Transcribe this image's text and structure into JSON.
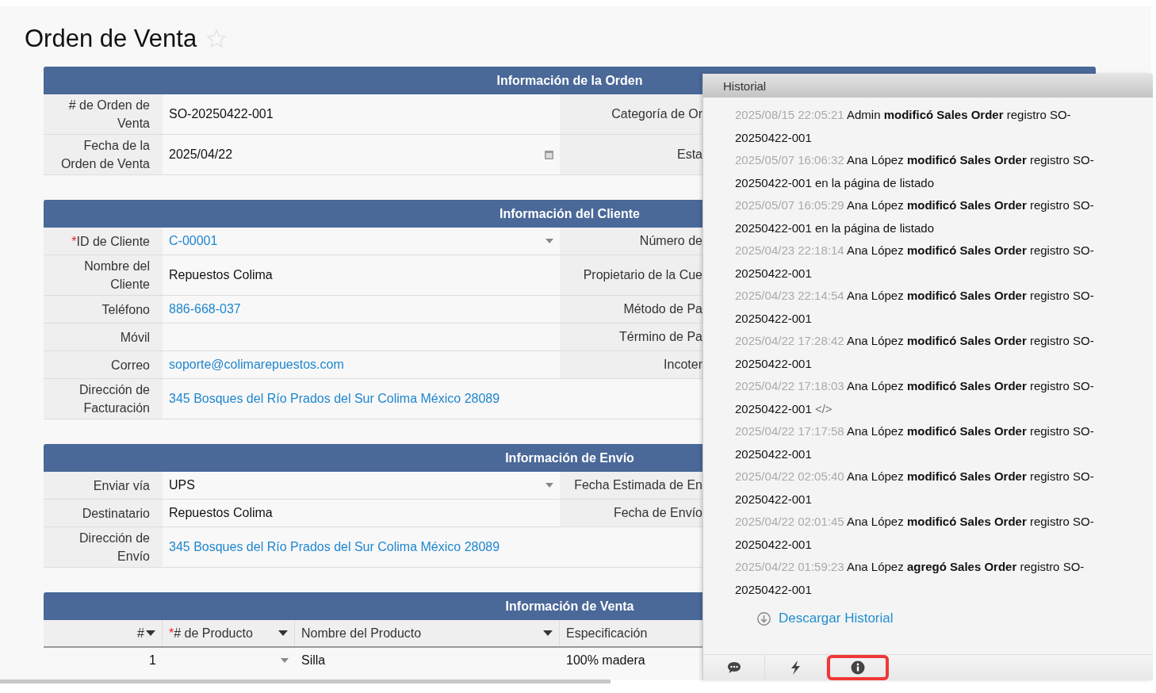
{
  "title": "Orden de Venta",
  "favorite": false,
  "sections": [
    {
      "title": "Información de la Orden",
      "rows": [
        {
          "label": "# de Orden de Venta",
          "kind": "text",
          "value": "SO-20250422-001",
          "right_label": "Categoría de Or"
        },
        {
          "label": "Fecha de la Orden de Venta",
          "kind": "date",
          "value": "2025/04/22",
          "right_label": "Esta"
        }
      ]
    },
    {
      "title": "Información del Cliente",
      "rows": [
        {
          "label": "ID de Cliente",
          "marker": "*",
          "kind": "select_link",
          "value": "C-00001",
          "right_label": "Número de"
        },
        {
          "label": "Nombre del Cliente",
          "kind": "text",
          "value": "Repuestos Colima",
          "right_label": "Propietario de la Cue"
        },
        {
          "label": "Teléfono",
          "kind": "link",
          "value": "886-668-037",
          "right_label": "Método de Pa"
        },
        {
          "label": "Móvil",
          "kind": "text",
          "right_label": "Término de Pa"
        },
        {
          "label": "Correo",
          "kind": "link",
          "value": "soporte@colimarepuestos.com",
          "right_label": "Incoter"
        },
        {
          "label": "Dirección de Facturación",
          "kind": "wide_link",
          "value": "345 Bosques del Río Prados del Sur Colima México 28089"
        }
      ]
    },
    {
      "title": "Información de Envío",
      "rows": [
        {
          "label": "Enviar vía",
          "kind": "select",
          "value": "UPS",
          "right_label": "Fecha Estimada de En"
        },
        {
          "label": "Destinatario",
          "kind": "text",
          "value": "Repuestos Colima",
          "right_label": "Fecha de Envío"
        },
        {
          "label": "Dirección de Envío",
          "kind": "wide_link",
          "value": "345 Bosques del Río Prados del Sur Colima México 28089"
        }
      ]
    }
  ],
  "sales": {
    "title": "Información de Venta",
    "columns": [
      {
        "label": "#",
        "menu": true
      },
      {
        "label": "# de Producto",
        "marker": "*",
        "menu": true
      },
      {
        "label": "Nombre del Producto",
        "menu": true
      },
      {
        "label": "Especificación",
        "menu": false
      }
    ],
    "rows": [
      {
        "number": "1",
        "product_name": "Silla",
        "specification": "100% madera"
      }
    ]
  },
  "history": {
    "title": "Historial",
    "entries": [
      {
        "time": "2025/08/15 22:05:21",
        "text": "Admin **modificó Sales Order** registro SO-20250422-001"
      },
      {
        "time": "2025/05/07 16:06:32",
        "text": "Ana López **modificó Sales Order** registro SO-20250422-001 en la página de listado"
      },
      {
        "time": "2025/05/07 16:05:29",
        "text": "Ana López **modificó Sales Order** registro SO-20250422-001 en la página de listado"
      },
      {
        "time": "2025/04/23 22:18:14",
        "text": "Ana López **modificó Sales Order** registro SO-20250422-001"
      },
      {
        "time": "2025/04/23 22:14:54",
        "text": "Ana López **modificó Sales Order** registro SO-20250422-001"
      },
      {
        "time": "2025/04/22 17:28:42",
        "text": "Ana López **modificó Sales Order** registro SO-20250422-001"
      },
      {
        "time": "2025/04/22 17:18:03",
        "text": "Ana López **modificó Sales Order** registro SO-20250422-001",
        "code_mark": "</>"
      },
      {
        "time": "2025/04/22 17:17:58",
        "text": "Ana López **modificó Sales Order** registro SO-20250422-001"
      },
      {
        "time": "2025/04/22 02:05:40",
        "text": "Ana López **modificó Sales Order** registro SO-20250422-001"
      },
      {
        "time": "2025/04/22 02:01:45",
        "text": "Ana López **modificó Sales Order** registro SO-20250422-001"
      },
      {
        "time": "2025/04/22 01:59:23",
        "text": "Ana López **agregó Sales Order** registro SO-20250422-001"
      }
    ],
    "download": "Descargar Historial",
    "tools": [
      {
        "kind": "comments",
        "selected": false
      },
      {
        "kind": "actions",
        "selected": false
      },
      {
        "kind": "info",
        "selected": true
      }
    ]
  }
}
